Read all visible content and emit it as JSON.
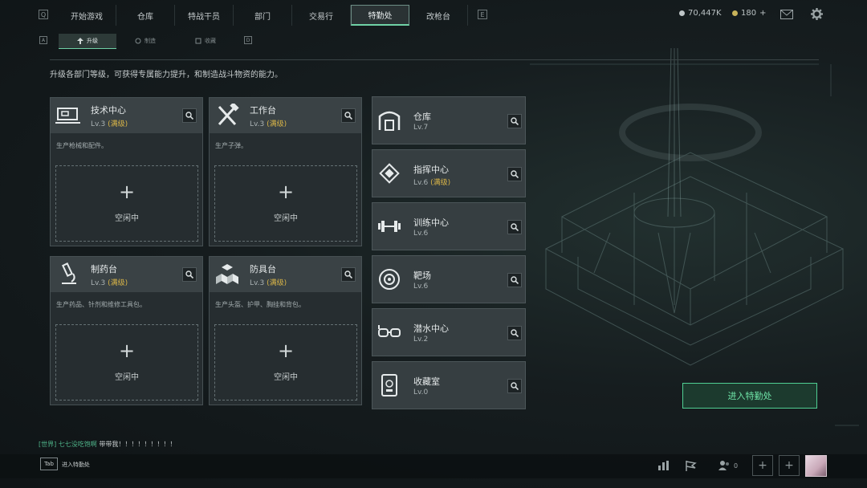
{
  "topnav": {
    "left_key": "Q",
    "right_key": "E",
    "tabs": [
      {
        "label": "开始游戏",
        "active": false
      },
      {
        "label": "仓库",
        "active": false
      },
      {
        "label": "特战干员",
        "active": false
      },
      {
        "label": "部门",
        "active": false
      },
      {
        "label": "交易行",
        "active": false
      },
      {
        "label": "特勤处",
        "active": true
      },
      {
        "label": "改枪台",
        "active": false
      }
    ],
    "currency_silver": "70,447K",
    "currency_gold": "180",
    "currency_gold_add": "+"
  },
  "subnav": {
    "left_key": "A",
    "right_key": "D",
    "tabs": [
      {
        "label": "升级",
        "active": true,
        "icon": "upgrade-icon"
      },
      {
        "label": "制造",
        "active": false,
        "icon": "craft-icon"
      },
      {
        "label": "收藏",
        "active": false,
        "icon": "collection-icon"
      }
    ]
  },
  "description": "升级各部门等级，可获得专属能力提升，和制造战斗物资的能力。",
  "workbenches": [
    {
      "name": "技术中心",
      "level": "Lv.3",
      "max_tag": "(满级)",
      "desc": "生产枪械和配件。",
      "slot_label": "空闲中",
      "icon": "computer-icon"
    },
    {
      "name": "工作台",
      "level": "Lv.3",
      "max_tag": "(满级)",
      "desc": "生产子弹。",
      "slot_label": "空闲中",
      "icon": "hammer-wrench-icon"
    },
    {
      "name": "制药台",
      "level": "Lv.3",
      "max_tag": "(满级)",
      "desc": "生产药品、针剂和维修工具包。",
      "slot_label": "空闲中",
      "icon": "microscope-icon"
    },
    {
      "name": "防具台",
      "level": "Lv.3",
      "max_tag": "(满级)",
      "desc": "生产头盔、护甲、胸挂和背包。",
      "slot_label": "空闲中",
      "icon": "cubes-icon"
    }
  ],
  "facilities": [
    {
      "name": "仓库",
      "level": "Lv.7",
      "max_tag": "",
      "icon": "warehouse-icon"
    },
    {
      "name": "指挥中心",
      "level": "Lv.6",
      "max_tag": "(满级)",
      "icon": "command-chip-icon"
    },
    {
      "name": "训练中心",
      "level": "Lv.6",
      "max_tag": "",
      "icon": "dumbbell-icon"
    },
    {
      "name": "靶场",
      "level": "Lv.6",
      "max_tag": "",
      "icon": "target-icon"
    },
    {
      "name": "潜水中心",
      "level": "Lv.2",
      "max_tag": "",
      "icon": "diving-mask-icon"
    },
    {
      "name": "收藏室",
      "level": "Lv.0",
      "max_tag": "",
      "icon": "trophy-case-icon"
    }
  ],
  "enter_button": "进入特勤处",
  "chat": {
    "channel": "[世界]",
    "user": "七七没吃饱啊",
    "message": "带带我！！！！！！！！！"
  },
  "bottom": {
    "key": "Tab",
    "label": "进入特勤处",
    "friends_count": "0"
  },
  "colors": {
    "accent_green": "#6fd1a6",
    "max_gold": "#d9b548",
    "enter_button_text": "#6ee3a7"
  }
}
